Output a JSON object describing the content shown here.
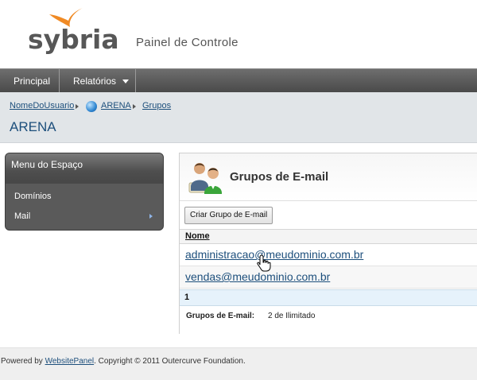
{
  "header": {
    "logo": "sybria",
    "panel_title": "Painel de Controle"
  },
  "nav": {
    "items": [
      {
        "label": "Principal"
      },
      {
        "label": "Relatórios"
      }
    ]
  },
  "breadcrumb": {
    "items": [
      "NomeDoUsuario",
      "ARENA",
      "Grupos"
    ]
  },
  "space_title": "ARENA",
  "left_menu": {
    "title": "Menu do Espaço",
    "items": [
      {
        "label": "Domínios"
      },
      {
        "label": "Mail"
      }
    ]
  },
  "content": {
    "title": "Grupos de E-mail",
    "create_button": "Criar Grupo de E-mail",
    "table": {
      "column_header": "Nome",
      "rows": [
        "administracao@meudominio.com.br",
        "vendas@meudominio.com.br"
      ]
    },
    "pager": "1",
    "summary": {
      "label": "Grupos de E-mail:",
      "value": "2 de Ilimitado"
    }
  },
  "footer": {
    "prefix": "Powered by ",
    "link": "WebsitePanel",
    "suffix": ". Copyright © 2011 Outercurve Foundation."
  },
  "colors": {
    "accent_orange": "#f08a24",
    "link_blue": "#1d4f7c",
    "nav_dark": "#4a4a4a"
  }
}
